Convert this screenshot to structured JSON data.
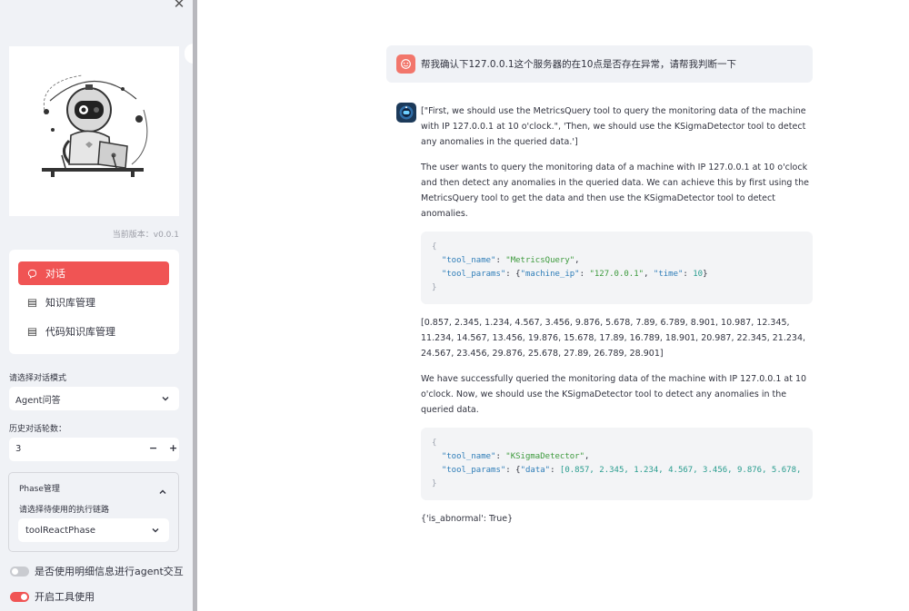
{
  "sidebar": {
    "version_text": "当前版本：v0.0.1",
    "nav": [
      {
        "label": "对话",
        "icon": "chat-bubble-icon",
        "active": true
      },
      {
        "label": "知识库管理",
        "icon": "database-icon",
        "active": false
      },
      {
        "label": "代码知识库管理",
        "icon": "database-icon",
        "active": false
      }
    ],
    "mode_label": "请选择对话模式",
    "mode_value": "Agent问答",
    "history_label": "历史对话轮数：",
    "history_value": "3",
    "minus": "−",
    "plus": "+",
    "phase": {
      "title": "Phase管理",
      "sub_label": "请选择待使用的执行链路",
      "value": "toolReactPhase"
    },
    "toggles": [
      {
        "label": "是否使用明细信息进行agent交互",
        "on": false
      },
      {
        "label": "开启工具使用",
        "on": true
      }
    ]
  },
  "chat": {
    "user_message": "帮我确认下127.0.0.1这个服务器的在10点是否存在异常，请帮我判断一下",
    "bot": {
      "plan": "[\"First, we should use the MetricsQuery tool to query the monitoring data of the machine with IP 127.0.0.1 at 10 o'clock.\", 'Then, we should use the KSigmaDetector tool to detect any anomalies in the queried data.']",
      "thought1": "The user wants to query the monitoring data of a machine with IP 127.0.0.1 at 10 o'clock and then detect any anomalies in the queried data. We can achieve this by first using the MetricsQuery tool to get the data and then use the KSigmaDetector tool to detect anomalies.",
      "code1": {
        "tool_name": "MetricsQuery",
        "machine_ip": "127.0.0.1",
        "time": "10"
      },
      "result1": "[0.857, 2.345, 1.234, 4.567, 3.456, 9.876, 5.678, 7.89, 6.789, 8.901, 10.987, 12.345, 11.234, 14.567, 13.456, 19.876, 15.678, 17.89, 16.789, 18.901, 20.987, 22.345, 21.234, 24.567, 23.456, 29.876, 25.678, 27.89, 26.789, 28.901]",
      "thought2": "We have successfully queried the monitoring data of the machine with IP 127.0.0.1 at 10 o'clock. Now, we should use the KSigmaDetector tool to detect any anomalies in the queried data.",
      "code2": {
        "tool_name": "KSigmaDetector",
        "data_preview": "[0.857, 2.345, 1.234, 4.567, 3.456, 9.876, 5.678,"
      },
      "final": "{'is_abnormal': True}"
    }
  },
  "colors": {
    "accent": "#f05454",
    "sidebar_bg": "#f0f2f6",
    "code_bg": "#f3f4f6"
  }
}
